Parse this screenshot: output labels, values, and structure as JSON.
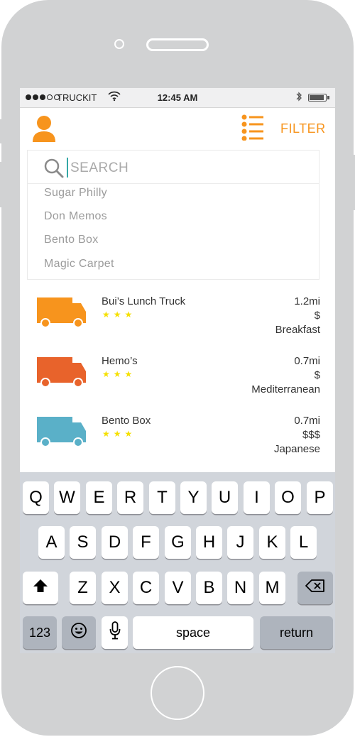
{
  "status_bar": {
    "carrier": "TRUCKIT",
    "time": "12:45 AM",
    "signal_filled": 3,
    "signal_total": 5,
    "battery_level": 0.9
  },
  "header": {
    "profile_icon": "user-icon",
    "list_view_icon": "list-icon",
    "filter_label": "FILTER",
    "accent_color": "#f7941d"
  },
  "search": {
    "placeholder": "SEARCH",
    "suggestions": [
      "Sugar Philly",
      "Don Memos",
      "Bento Box",
      "Magic Carpet"
    ]
  },
  "trucks": [
    {
      "name": "Bui’s Lunch Truck",
      "stars": "★★★",
      "distance": "1.2mi",
      "price": "$",
      "cuisine": "Breakfast",
      "color": "#f7941d"
    },
    {
      "name": "Hemo’s",
      "stars": "★★★",
      "distance": "0.7mi",
      "price": "$",
      "cuisine": "Mediterranean",
      "color": "#e8632b"
    },
    {
      "name": "Bento Box",
      "stars": "★★★",
      "distance": "0.7mi",
      "price": "$$$",
      "cuisine": "Japanese",
      "color": "#5ab0c8"
    }
  ],
  "keyboard": {
    "row1": [
      "Q",
      "W",
      "E",
      "R",
      "T",
      "Y",
      "U",
      "I",
      "O",
      "P"
    ],
    "row2": [
      "A",
      "S",
      "D",
      "F",
      "G",
      "H",
      "J",
      "K",
      "L"
    ],
    "row3": [
      "Z",
      "X",
      "C",
      "V",
      "B",
      "N",
      "M"
    ],
    "numbers_key": "123",
    "space_key": "space",
    "return_key": "return",
    "shift_icon": "shift-icon",
    "delete_icon": "backspace-icon",
    "emoji_icon": "emoji-icon",
    "mic_icon": "microphone-icon"
  }
}
